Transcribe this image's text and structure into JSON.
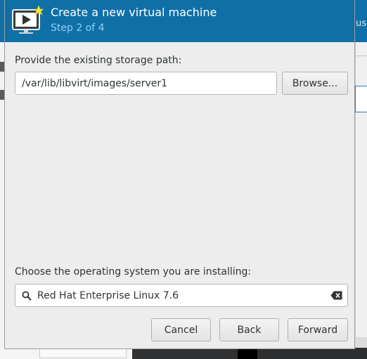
{
  "background": {
    "partial_text": "usa"
  },
  "dialog": {
    "title": "Create a new virtual machine",
    "step": "Step 2 of 4",
    "storage_label": "Provide the existing storage path:",
    "storage_path": "/var/lib/libvirt/images/server1",
    "browse_label": "Browse...",
    "os_label": "Choose the operating system you are installing:",
    "os_value": "Red Hat Enterprise Linux 7.6",
    "buttons": {
      "cancel": "Cancel",
      "back": "Back",
      "forward": "Forward"
    }
  },
  "colors": {
    "header": "#0f70a7",
    "step_text": "#8fd0f3",
    "dialog_bg": "#ededed"
  },
  "icons": [
    "virtual-machine-icon",
    "search-icon",
    "clear-text-icon"
  ]
}
